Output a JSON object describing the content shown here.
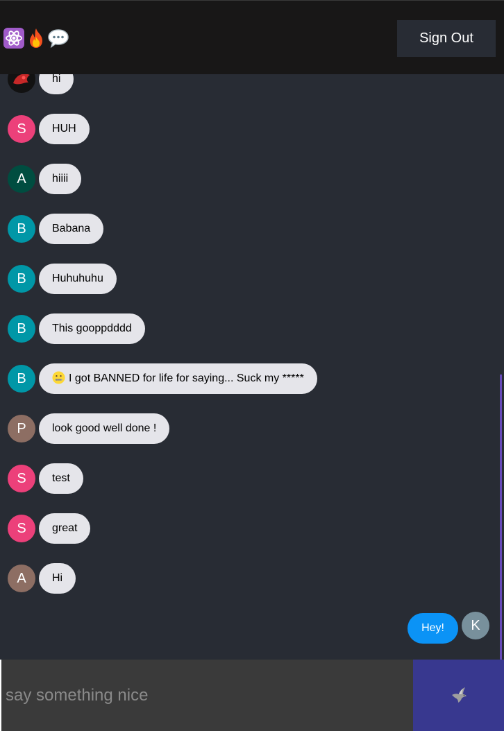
{
  "header": {
    "logo_icons": [
      "atom-icon",
      "fire-icon",
      "speech-bubble-icon"
    ],
    "sign_out_label": "Sign Out"
  },
  "messages": [
    {
      "avatar_type": "image",
      "avatar_icon": "profile-photo",
      "text": "hi"
    },
    {
      "avatar_letter": "S",
      "avatar_color": "#ec407a",
      "text": "HUH"
    },
    {
      "avatar_letter": "A",
      "avatar_color": "#004d40",
      "text": "hiiii"
    },
    {
      "avatar_letter": "B",
      "avatar_color": "#0097a7",
      "text": "Babana"
    },
    {
      "avatar_letter": "B",
      "avatar_color": "#0097a7",
      "text": "Huhuhuhu"
    },
    {
      "avatar_letter": "B",
      "avatar_color": "#0097a7",
      "text": "This gooppdddd"
    },
    {
      "avatar_letter": "B",
      "avatar_color": "#0097a7",
      "emoji_icon": "zipper-mouth-face-icon",
      "text": "I got BANNED for life for saying... Suck my *****"
    },
    {
      "avatar_letter": "P",
      "avatar_color": "#8d6e63",
      "text": "look good well done !"
    },
    {
      "avatar_letter": "S",
      "avatar_color": "#ec407a",
      "text": "test"
    },
    {
      "avatar_letter": "S",
      "avatar_color": "#ec407a",
      "text": "great"
    },
    {
      "avatar_letter": "A",
      "avatar_color": "#8d6e63",
      "text": "Hi"
    }
  ],
  "sent_message": {
    "text": "Hey!",
    "avatar_letter": "K",
    "avatar_color": "#78909c",
    "bubble_color": "#0b93f6"
  },
  "composer": {
    "placeholder": "say something nice",
    "value": "",
    "send_icon": "dove-icon"
  },
  "colors": {
    "header_bg": "#181717",
    "page_bg": "#282c34",
    "received_bubble": "#e5e5ea",
    "send_button_bg": "#38388f",
    "scrollbar": "#6649b8"
  }
}
